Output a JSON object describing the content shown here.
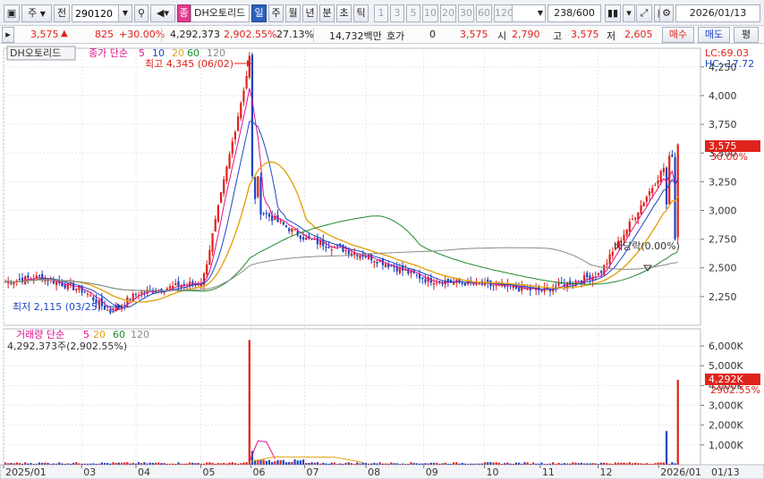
{
  "toolbar": {
    "market_label": "주",
    "prev_label": "전",
    "stock_code": "290120",
    "stock_badge": "종",
    "stock_name": "DH오토리드",
    "periods": [
      "일",
      "주",
      "월",
      "년",
      "분",
      "초",
      "틱"
    ],
    "active_period": "일",
    "intervals": [
      "1",
      "3",
      "5",
      "10",
      "20",
      "30",
      "60",
      "120"
    ],
    "count_value": "238",
    "count_total": "/600",
    "date_value": "2026/01/13"
  },
  "quote": {
    "price": "3,575",
    "change": "825",
    "change_pct": "+30.00%",
    "volume": "4,292,373",
    "volume_pct": "2,902.55%",
    "turnover_pct": "27.13%",
    "amount": "14,732백만",
    "hoga_label": "호가",
    "hoga_value": "0",
    "hoga_price": "3,575",
    "open_label": "시",
    "open_value": "2,790",
    "high_label": "고",
    "high_value": "3,575",
    "low_label": "저",
    "low_value": "2,605",
    "buy_button": "매수",
    "sell_button": "매도",
    "eval_button": "평"
  },
  "price_panel": {
    "title_chip": "DH오토리드",
    "legend_prefix": "종가 단순",
    "ma_periods": [
      "5",
      "10",
      "20",
      "60",
      "120"
    ],
    "lc_label": "LC:69.03",
    "hc_label": "HC:-17.72",
    "max_annotation": "최고 4,345 (06/02)",
    "min_annotation": "최저 2,115 (03/25)",
    "dividend_annotation": "배당락(0.00%)",
    "current_price_tag": "3,575",
    "current_pct_tag": "30.00%",
    "y_ticks": [
      "4,250",
      "4,000",
      "3,750",
      "3,500",
      "3,250",
      "3,000",
      "2,750",
      "2,500",
      "2,250"
    ]
  },
  "volume_panel": {
    "legend_prefix": "거래량 단순",
    "ma_periods": [
      "5",
      "20",
      "60",
      "120"
    ],
    "volume_text": "4,292,373주(2,902.55%)",
    "current_tag": "4,292K",
    "current_pct_tag": "2902.55%",
    "y_ticks": [
      "6,000K",
      "5,000K",
      "4,000K",
      "3,000K",
      "2,000K",
      "1,000K"
    ]
  },
  "x_axis": {
    "labels": [
      "2025/01",
      "03",
      "04",
      "05",
      "06",
      "07",
      "08",
      "09",
      "10",
      "11",
      "12",
      "2026/01"
    ],
    "right_label": "01/13"
  },
  "colors": {
    "up": "#e0221c",
    "down": "#1d46c4",
    "ma5": "#e0108b",
    "ma10": "#1d46c4",
    "ma20": "#e3a310",
    "ma60": "#1f8a2e",
    "ma120": "#8a8a8a"
  },
  "chart_data": {
    "type": "candlestick",
    "title": "DH오토리드",
    "price_ylim": [
      2000,
      4350
    ],
    "volume_ylim": [
      0,
      6500000
    ],
    "periods": [
      "2025/01",
      "03",
      "04",
      "05",
      "06",
      "07",
      "08",
      "09",
      "10",
      "11",
      "12",
      "2026/01"
    ],
    "price_keypoints": [
      {
        "x": "2025/01",
        "close": 2380
      },
      {
        "x": "02",
        "close": 2420
      },
      {
        "x": "03",
        "close": 2300
      },
      {
        "x": "03/25",
        "close": 2115
      },
      {
        "x": "04",
        "close": 2280
      },
      {
        "x": "05",
        "close": 2380
      },
      {
        "x": "06/02",
        "close": 4345
      },
      {
        "x": "06",
        "close": 3000
      },
      {
        "x": "07",
        "close": 2750
      },
      {
        "x": "08",
        "close": 2600
      },
      {
        "x": "09",
        "close": 2400
      },
      {
        "x": "10",
        "close": 2350
      },
      {
        "x": "11",
        "close": 2300
      },
      {
        "x": "12",
        "close": 2450
      },
      {
        "x": "2026/01/13",
        "close": 3575
      }
    ],
    "volume_keypoints": [
      {
        "x": "06/02",
        "volume": 6300000
      },
      {
        "x": "2026/01/12",
        "volume": 1700000
      },
      {
        "x": "2026/01/13",
        "volume": 4292373
      }
    ]
  }
}
